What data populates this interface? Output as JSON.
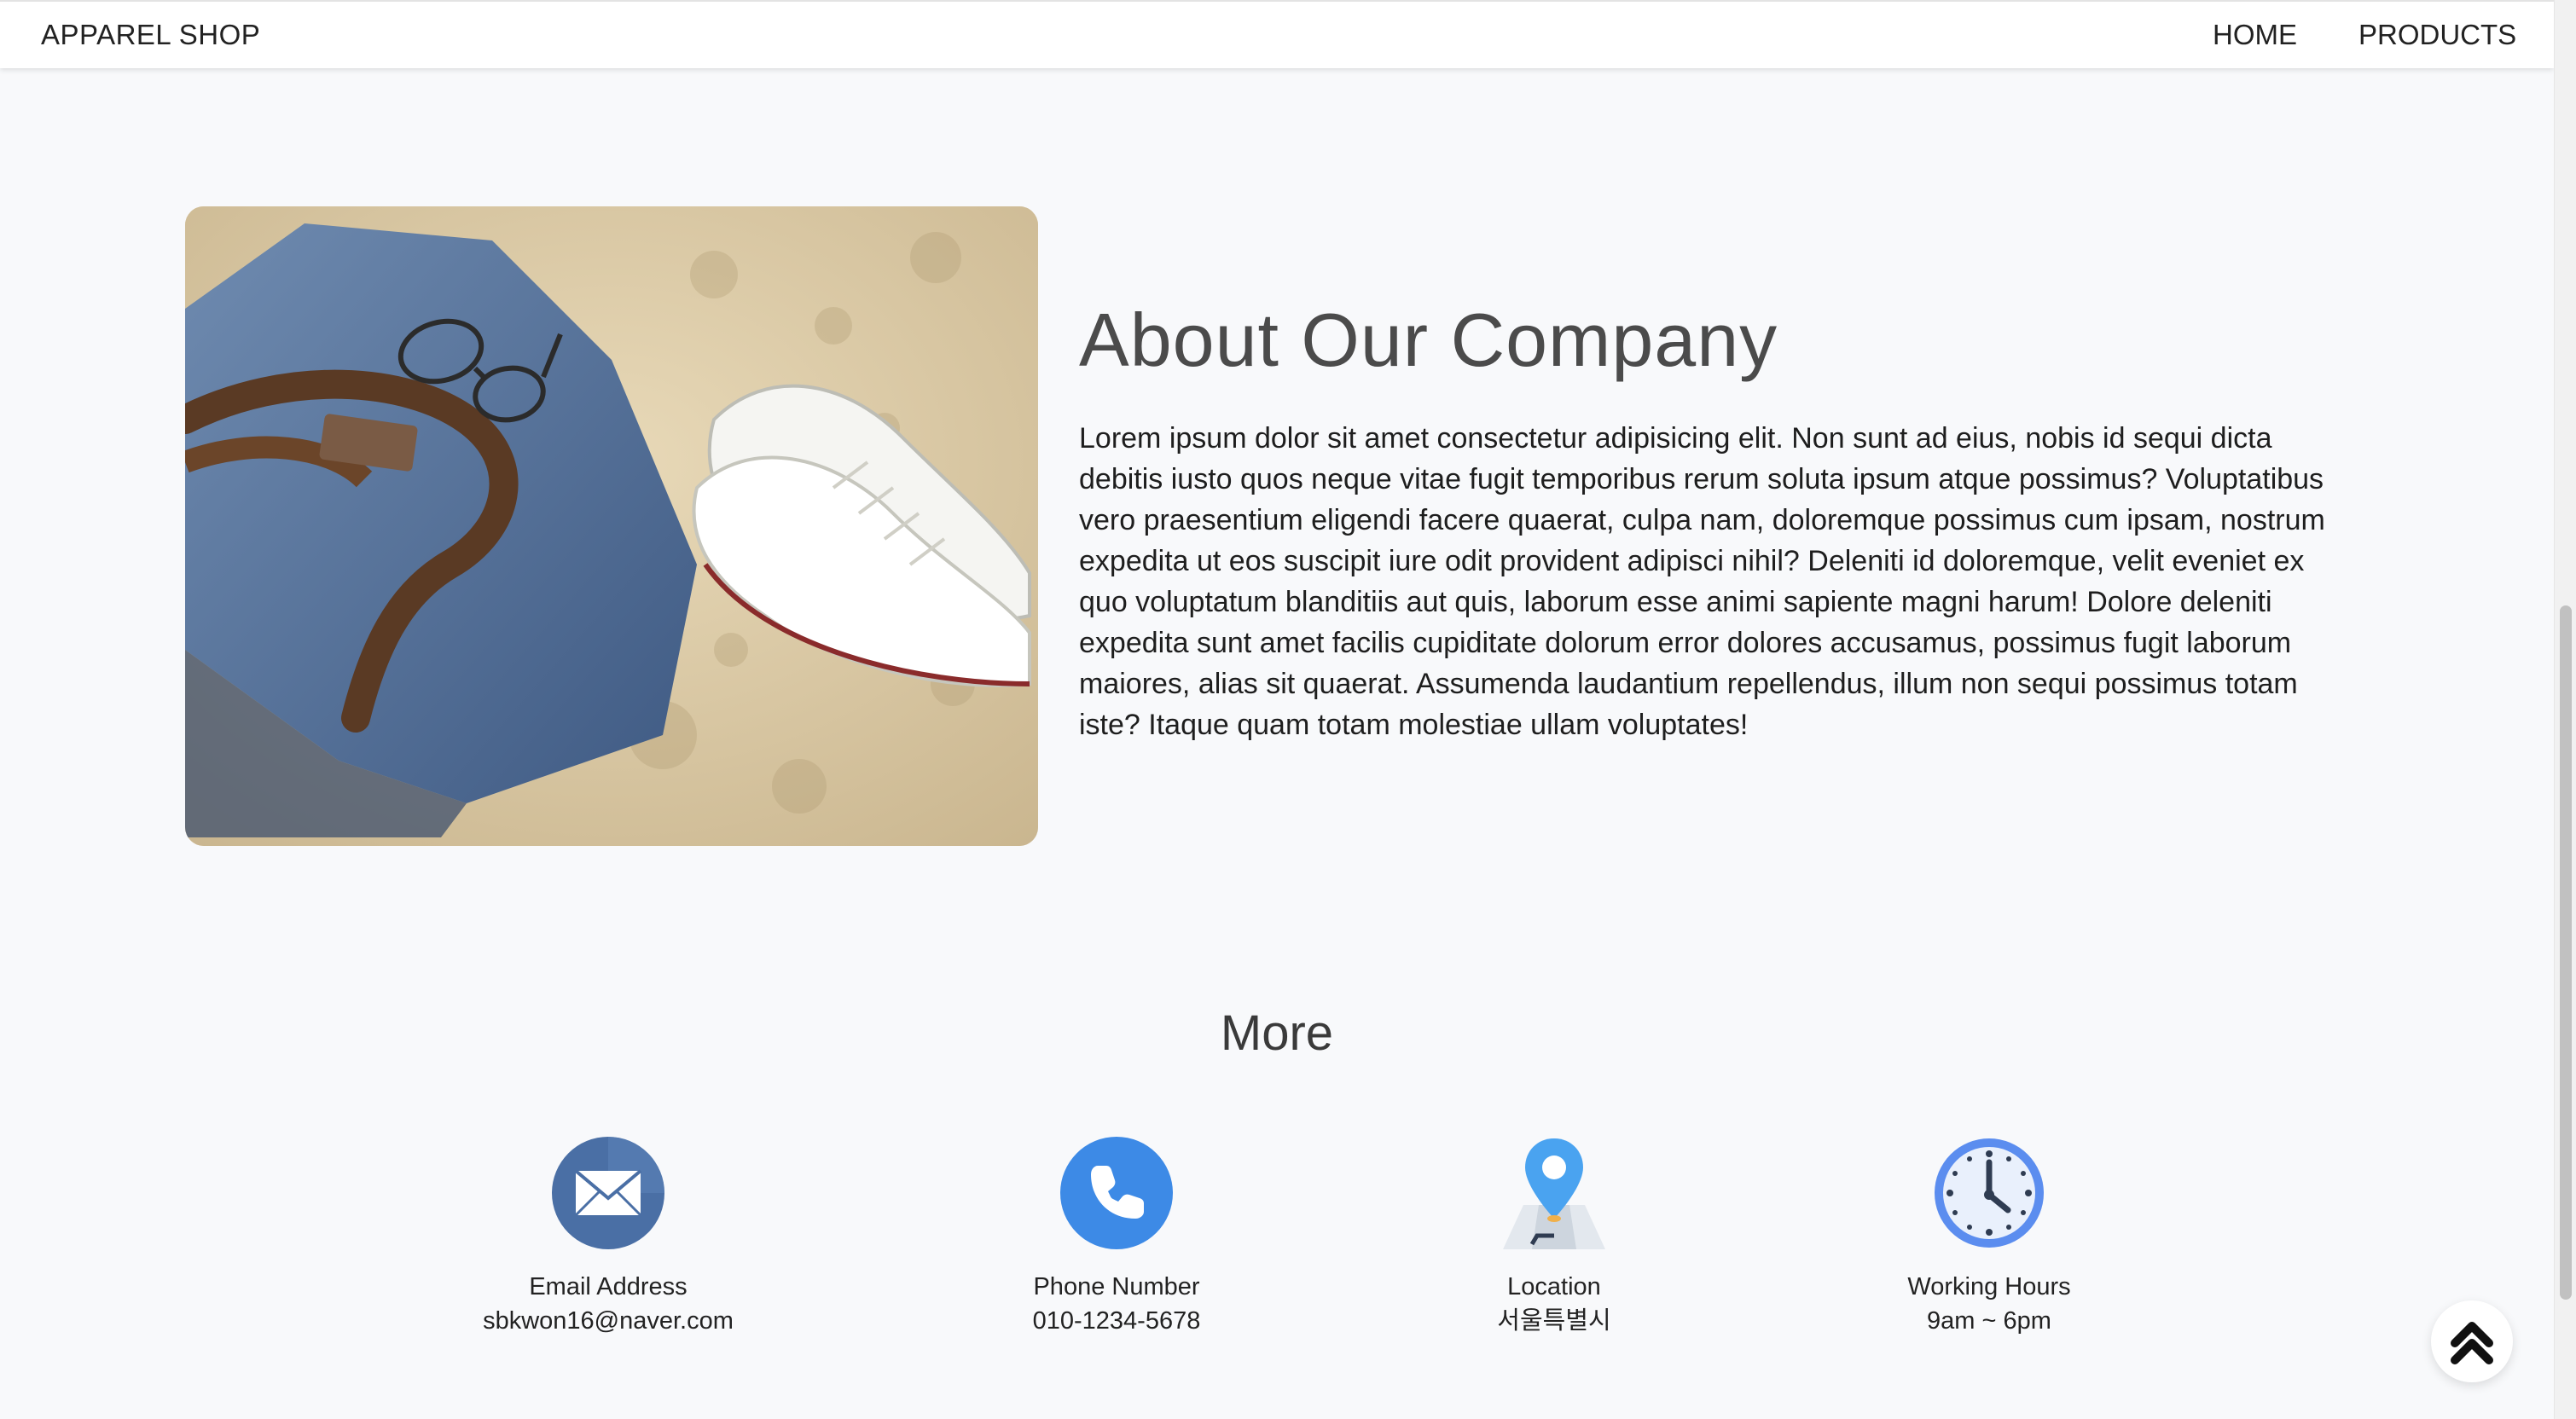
{
  "navbar": {
    "brand": "APPAREL SHOP",
    "links": [
      {
        "label": "HOME"
      },
      {
        "label": "PRODUCTS"
      }
    ]
  },
  "about": {
    "title": "About Our Company",
    "body": "Lorem ipsum dolor sit amet consectetur adipisicing elit. Non sunt ad eius, nobis id sequi dicta debitis iusto quos neque vitae fugit temporibus rerum soluta ipsum atque possimus? Voluptatibus vero praesentium eligendi facere quaerat, culpa nam, doloremque possimus cum ipsam, nostrum expedita ut eos suscipit iure odit provident adipisci nihil? Deleniti id doloremque, velit eveniet ex quo voluptatum blanditiis aut quis, laborum esse animi sapiente magni harum! Dolore deleniti expedita sunt amet facilis cupiditate dolorum error dolores accusamus, possimus fugit laborum maiores, alias sit quaerat. Assumenda laudantium repellendus, illum non sequi possimus totam iste? Itaque quam totam molestiae ullam voluptates!",
    "image_icon": "denim-bag-and-sneakers-on-sand-photo"
  },
  "more": {
    "title": "More",
    "items": [
      {
        "label": "Email Address",
        "value": "sbkwon16@naver.com",
        "icon": "envelope-icon"
      },
      {
        "label": "Phone Number",
        "value": "010-1234-5678",
        "icon": "phone-icon"
      },
      {
        "label": "Location",
        "value": "서울특별시",
        "icon": "map-pin-icon"
      },
      {
        "label": "Working Hours",
        "value": "9am ~ 6pm",
        "icon": "clock-icon"
      }
    ]
  },
  "back_to_top": {
    "icon": "double-chevron-up-icon"
  },
  "colors": {
    "background": "#f8f9fb",
    "navbar": "#ffffff",
    "email_icon": "#4a6fa5",
    "phone_icon": "#3d8ae6",
    "location_pin": "#4aa3f0",
    "clock_ring": "#5b8def"
  }
}
